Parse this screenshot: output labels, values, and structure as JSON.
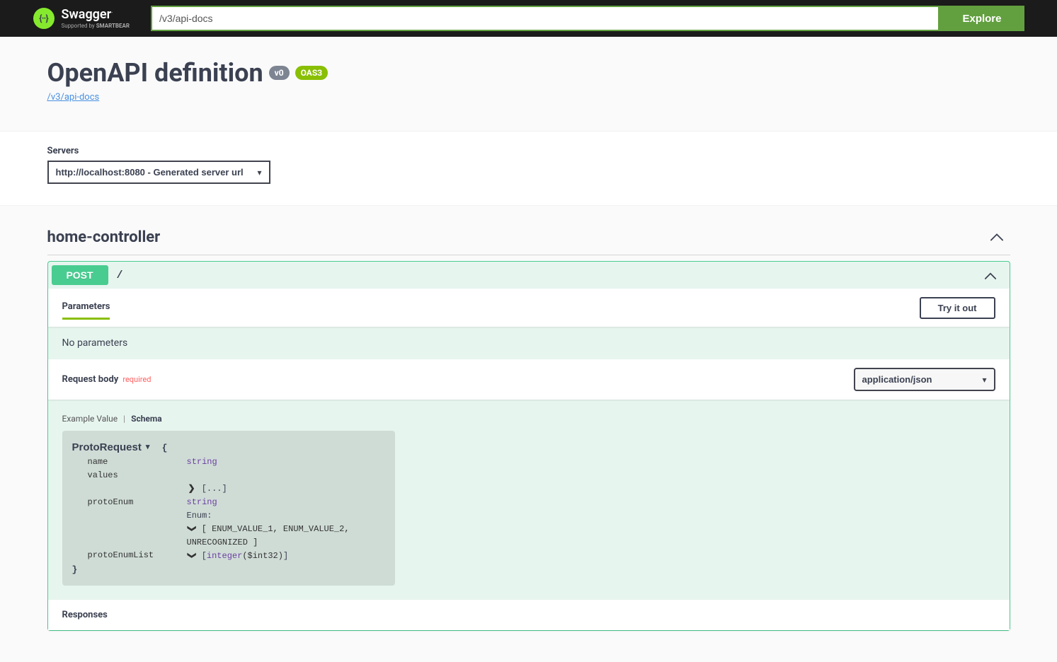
{
  "topbar": {
    "logo_text": "Swagger",
    "logo_icon_glyph": "{··}",
    "logo_sub_prefix": "Supported by ",
    "logo_sub_brand": "SMARTBEAR",
    "input_value": "/v3/api-docs",
    "explore_label": "Explore"
  },
  "info": {
    "title": "OpenAPI definition",
    "version_badge": "v0",
    "oas_badge": "OAS3",
    "base_url": "/v3/api-docs"
  },
  "servers": {
    "label": "Servers",
    "selected": "http://localhost:8080 - Generated server url"
  },
  "tag": {
    "name": "home-controller"
  },
  "operation": {
    "method": "POST",
    "path": "/",
    "parameters_tab": "Parameters",
    "try_it_out": "Try it out",
    "no_parameters": "No parameters",
    "request_body_label": "Request body",
    "required_label": "required",
    "content_type": "application/json",
    "example_tab": "Example Value",
    "schema_tab": "Schema",
    "model_name": "ProtoRequest",
    "props": {
      "name": {
        "key": "name",
        "type": "string"
      },
      "values": {
        "key": "values",
        "preview": "[...]"
      },
      "protoEnum": {
        "key": "protoEnum",
        "type": "string",
        "enum_label": "Enum:",
        "enum_values": "[ ENUM_VALUE_1, ENUM_VALUE_2, UNRECOGNIZED ]"
      },
      "protoEnumList": {
        "key": "protoEnumList",
        "int_part": "integer",
        "fmt_part": "($int32)"
      }
    },
    "responses_label": "Responses"
  }
}
